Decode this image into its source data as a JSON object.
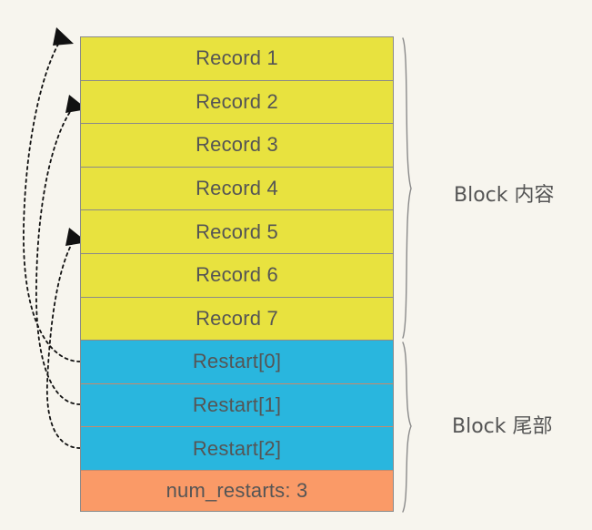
{
  "diagram": {
    "title_present": false,
    "background_color": "#f7f5ee",
    "colors": {
      "record_fill": "#e8e23f",
      "restart_fill": "#29b6de",
      "footer_fill": "#fa9a67",
      "stroke": "#8a8a8a",
      "text": "#555555",
      "arrow": "#111111",
      "bracket": "#8a8a8a"
    },
    "rows": [
      {
        "label": "Record 1",
        "kind": "record"
      },
      {
        "label": "Record 2",
        "kind": "record"
      },
      {
        "label": "Record 3",
        "kind": "record"
      },
      {
        "label": "Record 4",
        "kind": "record"
      },
      {
        "label": "Record 5",
        "kind": "record"
      },
      {
        "label": "Record 6",
        "kind": "record"
      },
      {
        "label": "Record 7",
        "kind": "record"
      },
      {
        "label": "Restart[0]",
        "kind": "restart"
      },
      {
        "label": "Restart[1]",
        "kind": "restart"
      },
      {
        "label": "Restart[2]",
        "kind": "restart"
      },
      {
        "label": "num_restarts: 3",
        "kind": "footer"
      }
    ],
    "brackets": [
      {
        "label": "Block  内容",
        "covers": "Record 1 - Record 7"
      },
      {
        "label": "Block  尾部",
        "covers": "Restart[0] - num_restarts: 3"
      }
    ],
    "pointers": [
      {
        "from": "Restart[0]",
        "to": "Record 1",
        "style": "dotted-curved-arrow"
      },
      {
        "from": "Restart[1]",
        "to": "Record 2",
        "style": "dotted-curved-arrow"
      },
      {
        "from": "Restart[2]",
        "to": "Record 5",
        "style": "dotted-curved-arrow"
      }
    ]
  }
}
